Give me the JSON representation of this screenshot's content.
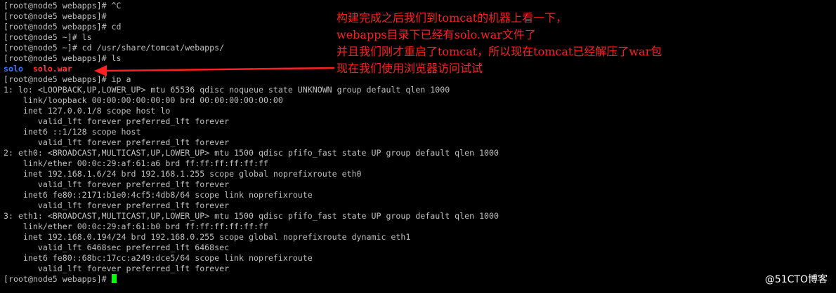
{
  "terminal": {
    "lines": [
      {
        "segments": [
          {
            "text": "[root@node5 webapps]# ^C"
          }
        ]
      },
      {
        "segments": [
          {
            "text": "[root@node5 webapps]#"
          }
        ]
      },
      {
        "segments": [
          {
            "text": "[root@node5 webapps]# cd"
          }
        ]
      },
      {
        "segments": [
          {
            "text": "[root@node5 ~]# ls"
          }
        ]
      },
      {
        "segments": [
          {
            "text": "[root@node5 ~]# cd /usr/share/tomcat/webapps/"
          }
        ]
      },
      {
        "segments": [
          {
            "text": "[root@node5 webapps]# ls"
          }
        ]
      },
      {
        "segments": [
          {
            "text": "solo",
            "kind": "dir"
          },
          {
            "text": "  "
          },
          {
            "text": "solo.war",
            "kind": "war"
          }
        ]
      },
      {
        "segments": [
          {
            "text": "[root@node5 webapps]# ip a"
          }
        ]
      },
      {
        "segments": [
          {
            "text": "1: lo: <LOOPBACK,UP,LOWER_UP> mtu 65536 qdisc noqueue state UNKNOWN group default qlen 1000"
          }
        ]
      },
      {
        "segments": [
          {
            "text": "    link/loopback 00:00:00:00:00:00 brd 00:00:00:00:00:00"
          }
        ]
      },
      {
        "segments": [
          {
            "text": "    inet 127.0.0.1/8 scope host lo"
          }
        ]
      },
      {
        "segments": [
          {
            "text": "       valid_lft forever preferred_lft forever"
          }
        ]
      },
      {
        "segments": [
          {
            "text": "    inet6 ::1/128 scope host"
          }
        ]
      },
      {
        "segments": [
          {
            "text": "       valid_lft forever preferred_lft forever"
          }
        ]
      },
      {
        "segments": [
          {
            "text": "2: eth0: <BROADCAST,MULTICAST,UP,LOWER_UP> mtu 1500 qdisc pfifo_fast state UP group default qlen 1000"
          }
        ]
      },
      {
        "segments": [
          {
            "text": "    link/ether 00:0c:29:af:61:a6 brd ff:ff:ff:ff:ff:ff"
          }
        ]
      },
      {
        "segments": [
          {
            "text": "    inet 192.168.1.6/24 brd 192.168.1.255 scope global noprefixroute eth0"
          }
        ]
      },
      {
        "segments": [
          {
            "text": "       valid_lft forever preferred_lft forever"
          }
        ]
      },
      {
        "segments": [
          {
            "text": "    inet6 fe80::2171:b1e0:4cf5:4db8/64 scope link noprefixroute"
          }
        ]
      },
      {
        "segments": [
          {
            "text": "       valid_lft forever preferred_lft forever"
          }
        ]
      },
      {
        "segments": [
          {
            "text": "3: eth1: <BROADCAST,MULTICAST,UP,LOWER_UP> mtu 1500 qdisc pfifo_fast state UP group default qlen 1000"
          }
        ]
      },
      {
        "segments": [
          {
            "text": "    link/ether 00:0c:29:af:61:b0 brd ff:ff:ff:ff:ff:ff"
          }
        ]
      },
      {
        "segments": [
          {
            "text": "    inet 192.168.0.194/24 brd 192.168.0.255 scope global noprefixroute dynamic eth1"
          }
        ]
      },
      {
        "segments": [
          {
            "text": "       valid_lft 6468sec preferred_lft 6468sec"
          }
        ]
      },
      {
        "segments": [
          {
            "text": "    inet6 fe80::68bc:17cc:a249:dce5/64 scope link noprefixroute"
          }
        ]
      },
      {
        "segments": [
          {
            "text": "       valid_lft forever preferred_lft forever"
          }
        ]
      },
      {
        "segments": [
          {
            "text": "[root@node5 webapps]# "
          }
        ],
        "cursor": true
      }
    ]
  },
  "annotation": {
    "lines": [
      "构建完成之后我们到tomcat的机器上看一下，",
      "webapps目录下已经有solo.war文件了",
      "并且我们刚才重启了tomcat，所以现在tomcat已经解压了war包",
      "现在我们使用浏览器访问试试"
    ]
  },
  "watermark": "@51CTO博客",
  "colors": {
    "background": "#000000",
    "text": "#c0c0c0",
    "directory": "#3b78ff",
    "archive": "#ff3b3b",
    "annotation": "#ff2020",
    "arrow": "#ff2020",
    "cursor": "#00ff00",
    "watermark": "#ffffff"
  },
  "icons": {
    "annotation_arrow": "arrow-left-icon",
    "cursor": "block-cursor"
  }
}
